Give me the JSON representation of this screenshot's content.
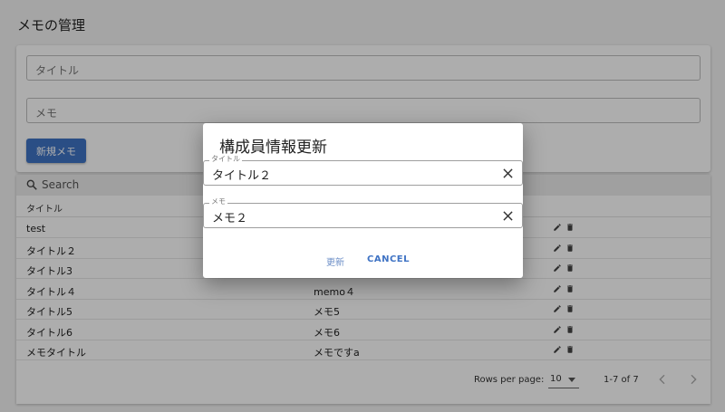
{
  "page": {
    "title": "メモの管理"
  },
  "form": {
    "title_placeholder": "タイトル",
    "memo_placeholder": "メモ",
    "new_button": "新規メモ"
  },
  "table": {
    "search_placeholder": "Search",
    "columns": [
      "タイトル",
      ""
    ],
    "rows": [
      {
        "title": "test",
        "memo": ""
      },
      {
        "title": "タイトル２",
        "memo": ""
      },
      {
        "title": "タイトル3",
        "memo": ""
      },
      {
        "title": "タイトル４",
        "memo": "memo４"
      },
      {
        "title": "タイトル5",
        "memo": "メモ5"
      },
      {
        "title": "タイトル6",
        "memo": "メモ6"
      },
      {
        "title": "メモタイトル",
        "memo": "メモですa"
      }
    ],
    "rows_per_page_label": "Rows per page:",
    "rows_per_page": "10",
    "range": "1-7 of 7"
  },
  "dialog": {
    "title": "構成員情報更新",
    "title_field": {
      "label": "タイトル",
      "value": "タイトル２"
    },
    "memo_field": {
      "label": "メモ",
      "value": "メモ２"
    },
    "update_button": "更新",
    "cancel_button": "CANCEL"
  },
  "icons": {
    "edit": "pencil-icon",
    "delete": "trash-icon",
    "search": "search-icon",
    "clear": "close-icon"
  },
  "colors": {
    "primary": "#3f73c4"
  }
}
